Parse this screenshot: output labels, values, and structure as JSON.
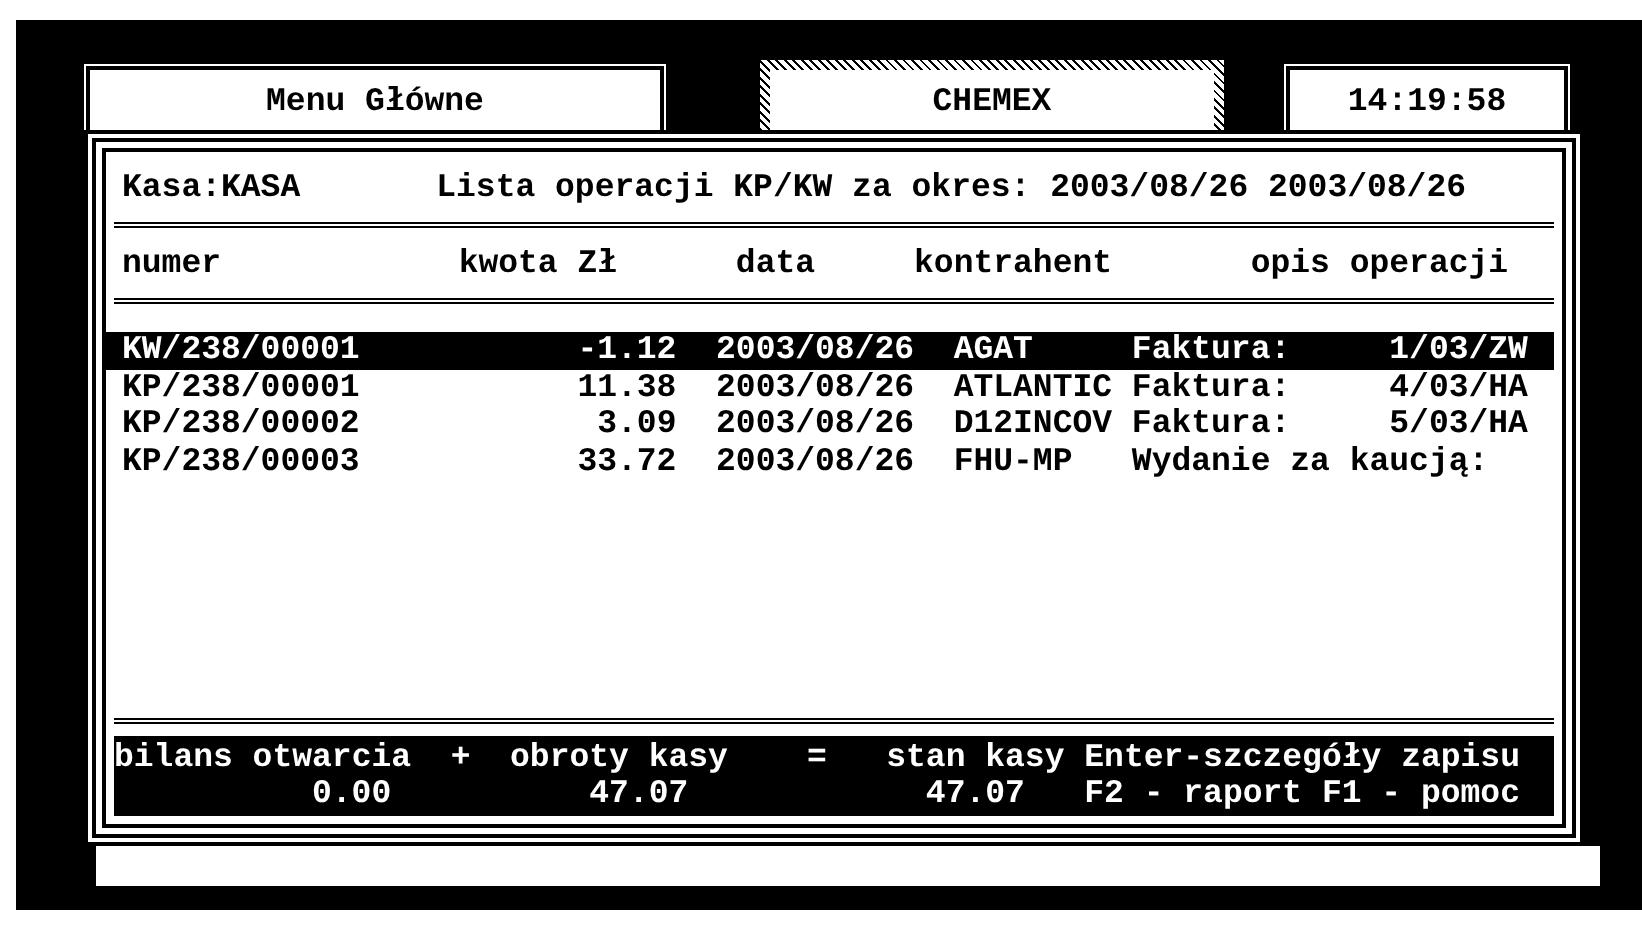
{
  "top_bar": {
    "menu_title": "Menu Główne",
    "company": "CHEMEX",
    "clock": "14:19:58"
  },
  "panel": {
    "cash_register": "Kasa:KASA",
    "list_title": "Lista operacji KP/KW za okres: 2003/08/26 2003/08/26"
  },
  "table": {
    "columns": [
      "numer",
      "kwota Zł",
      "data",
      "kontrahent",
      "opis operacji"
    ],
    "rows": [
      {
        "numer": "KW/238/00001",
        "kwota": "-1.12",
        "data": "2003/08/26",
        "kontrahent": "AGAT",
        "opis": "Faktura:     1/03/ZW",
        "selected": true
      },
      {
        "numer": "KP/238/00001",
        "kwota": "11.38",
        "data": "2003/08/26",
        "kontrahent": "ATLANTIC",
        "opis": "Faktura:     4/03/HA",
        "selected": false
      },
      {
        "numer": "KP/238/00002",
        "kwota": "3.09",
        "data": "2003/08/26",
        "kontrahent": "D12INCOV",
        "opis": "Faktura:     5/03/HA",
        "selected": false
      },
      {
        "numer": "KP/238/00003",
        "kwota": "33.72",
        "data": "2003/08/26",
        "kontrahent": "FHU-MP",
        "opis": "Wydanie za kaucją:",
        "selected": false
      }
    ]
  },
  "footer": {
    "labels": [
      "bilans otwarcia",
      "+",
      "obroty kasy",
      "=",
      "stan kasy",
      "Enter-szczegóły zapisu"
    ],
    "values": [
      "0.00",
      "47.07",
      "47.07",
      "F2 - raport F1 - pomoc"
    ]
  }
}
